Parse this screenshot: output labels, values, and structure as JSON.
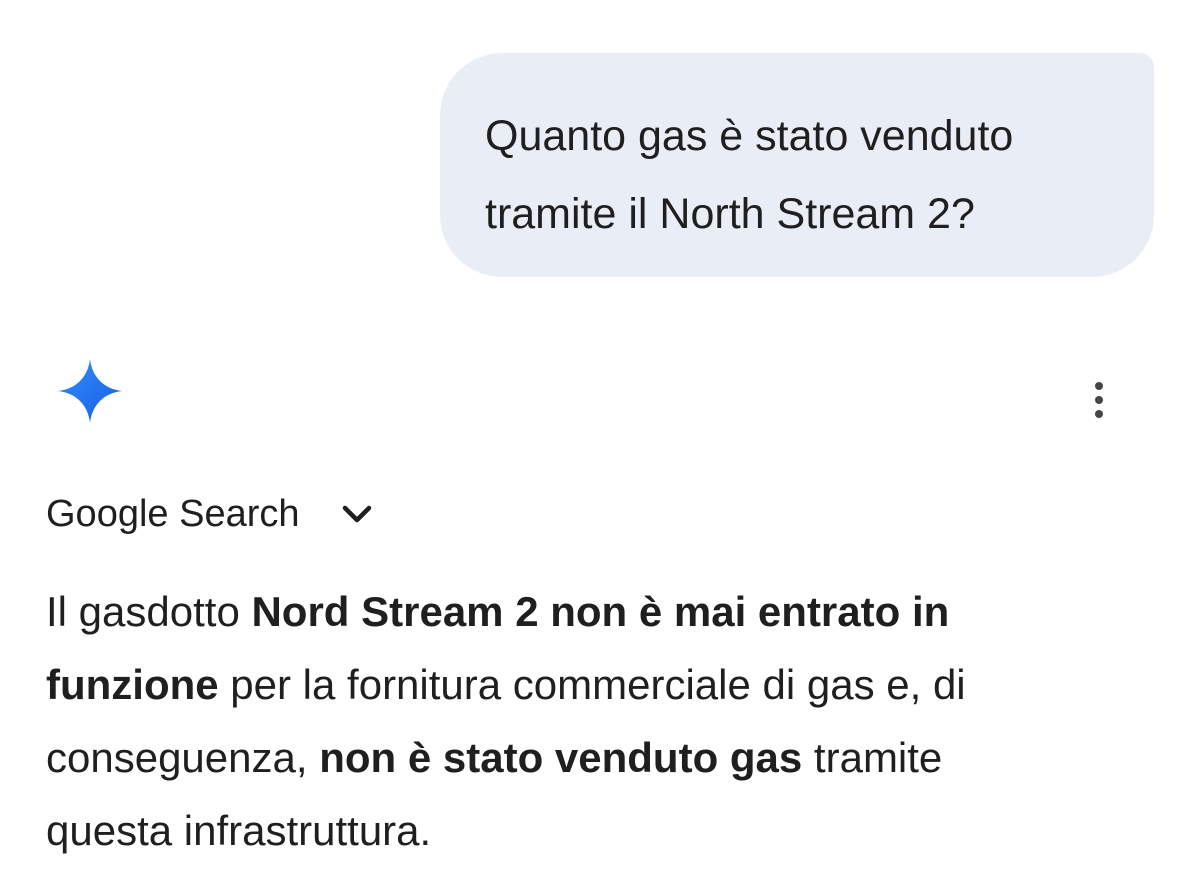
{
  "user_message": {
    "line1": "Quanto gas è stato venduto",
    "line2": "tramite il North Stream 2?"
  },
  "response": {
    "spark_icon": "gemini-spark-icon",
    "more_icon": "more-vert-icon",
    "source_label": "Google Search",
    "source_chevron_icon": "chevron-down-icon",
    "text": {
      "l1_a": "Il gasdotto ",
      "l1_b": "Nord Stream 2 non è mai entrato in",
      "l2_a": "funzione",
      "l2_b": " per la fornitura commerciale di gas e, di",
      "l3_a": "conseguenza, ",
      "l3_b": "non è stato venduto gas",
      "l3_c": " tramite",
      "l4_a": "questa infrastruttura."
    }
  },
  "colors": {
    "user_bubble_bg": "#e9eef6",
    "text": "#1f1f1f",
    "spark_gradient": [
      "#4285f4",
      "#1a73e8"
    ]
  }
}
